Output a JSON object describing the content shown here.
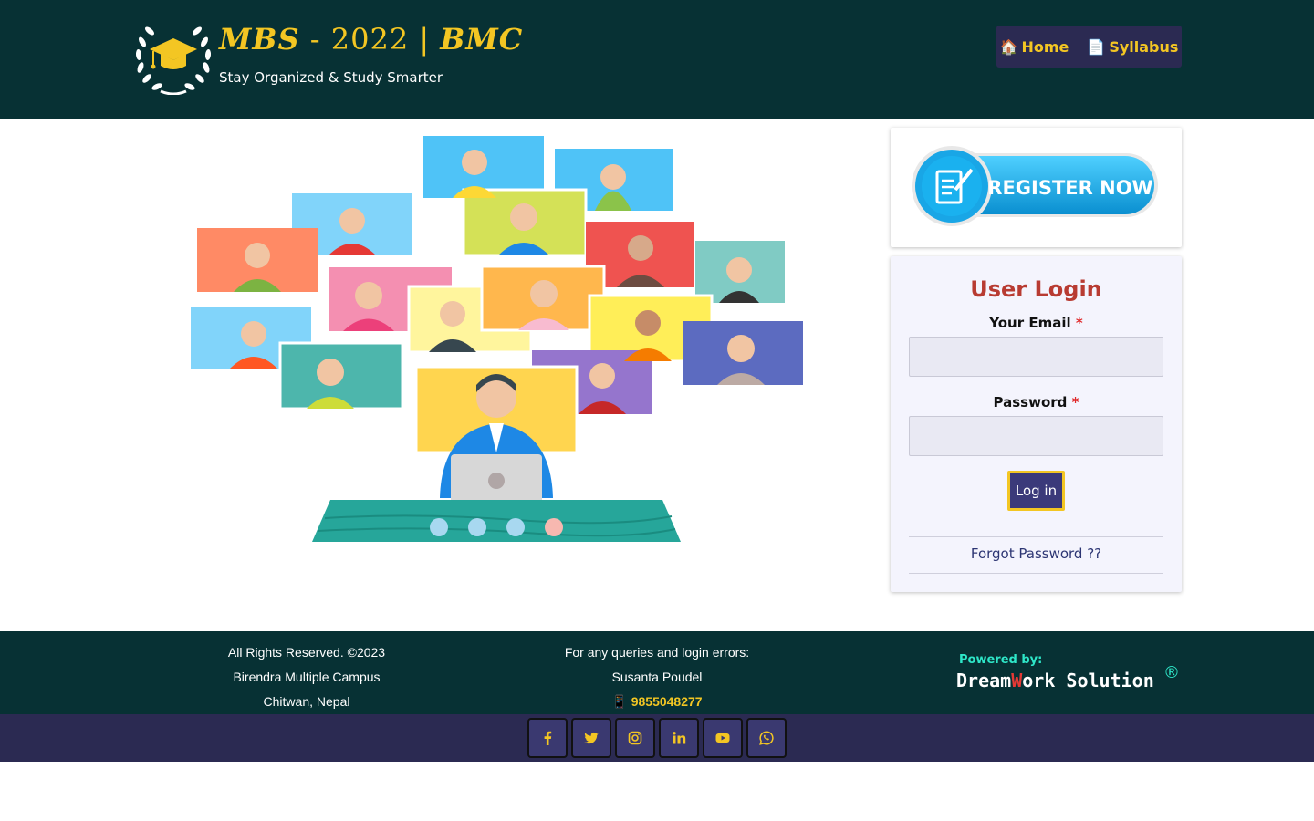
{
  "header": {
    "title_main": "MBS",
    "title_sep": " - 2022 | ",
    "title_campus": "BMC",
    "tagline": "Stay Organized & Study Smarter",
    "logo_icon": "graduation-cap-wreath-icon"
  },
  "nav": {
    "items": [
      {
        "icon": "🏠",
        "label": "Home"
      },
      {
        "icon": "📄",
        "label": "Syllabus"
      }
    ]
  },
  "register": {
    "label": "REGISTER NOW",
    "icon": "document-pen-icon"
  },
  "login": {
    "title": "User Login",
    "email_label": "Your Email",
    "password_label": "Password",
    "required_mark": "*",
    "email_value": "",
    "password_value": "",
    "submit_label": "Log in",
    "forgot_label": "Forgot Password ??"
  },
  "footer": {
    "left": [
      "All Rights Reserved. ©2023",
      "Birendra Multiple Campus",
      "Chitwan, Nepal"
    ],
    "mid_title": "For any queries and login errors:",
    "mid_name": "Susanta Poudel",
    "phone_icon": "📱",
    "phone": "9855048277",
    "powered_by": "Powered by:",
    "brand_pre": "Dream",
    "brand_w": "W",
    "brand_post": "ork Solution",
    "brand_reg": "®"
  },
  "social": [
    "facebook-icon",
    "twitter-icon",
    "instagram-icon",
    "linkedin-icon",
    "youtube-icon",
    "whatsapp-icon"
  ],
  "colors": {
    "header_bg": "#073134",
    "accent_yellow": "#f3c623",
    "nav_bg": "#2b2a52",
    "login_title": "#b83b32",
    "register_blue": "#11a7e3"
  }
}
